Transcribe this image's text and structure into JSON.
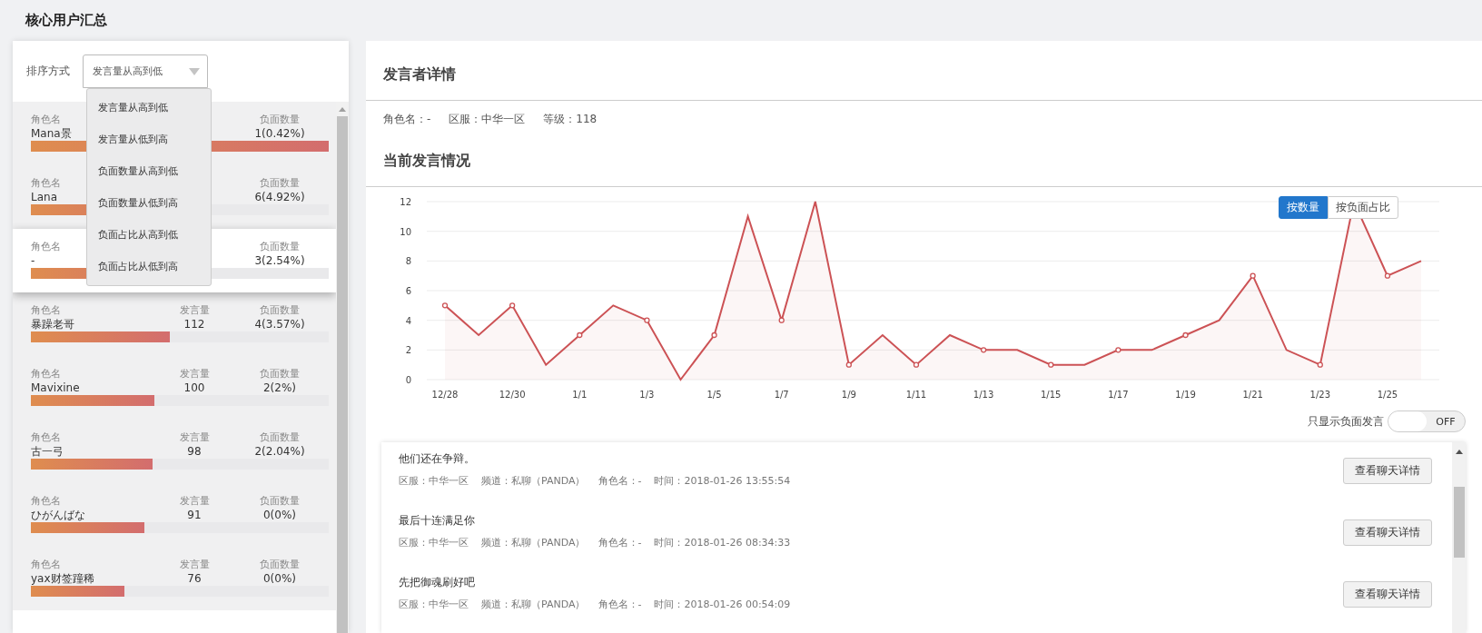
{
  "page_title": "核心用户汇总",
  "sort": {
    "label": "排序方式",
    "value": "发言量从高到低",
    "expanded": true,
    "options": [
      "发言量从高到低",
      "发言量从低到高",
      "负面数量从高到低",
      "负面数量从低到高",
      "负面占比从高到低",
      "负面占比从低到高"
    ]
  },
  "users": [
    {
      "name_label": "角色名",
      "name": "Mana景",
      "negative_label": "负面数量",
      "negative": "1(0.42%)",
      "level": 1.0,
      "selected": false
    },
    {
      "name_label": "角色名",
      "name": "Lana",
      "negative_label": "负面数量",
      "negative": "6(4.92%)",
      "level": 0.51,
      "selected": false
    },
    {
      "name_label": "角色名",
      "name": "-",
      "negative_label": "负面数量",
      "negative": "3(2.54%)",
      "level": 0.49,
      "selected": true
    },
    {
      "name_label": "角色名",
      "name": "暴躁老哥",
      "speech_label": "发言量",
      "speech": "112",
      "negative_label": "负面数量",
      "negative": "4(3.57%)",
      "level": 0.466,
      "selected": false
    },
    {
      "name_label": "角色名",
      "name": "Mavixine",
      "speech_label": "发言量",
      "speech": "100",
      "negative_label": "负面数量",
      "negative": "2(2%)",
      "level": 0.415,
      "selected": false
    },
    {
      "name_label": "角色名",
      "name": "古一弓",
      "speech_label": "发言量",
      "speech": "98",
      "negative_label": "负面数量",
      "negative": "2(2.04%)",
      "level": 0.409,
      "selected": false
    },
    {
      "name_label": "角色名",
      "name": "ひがんばな",
      "speech_label": "发言量",
      "speech": "91",
      "negative_label": "负面数量",
      "negative": "0(0%)",
      "level": 0.381,
      "selected": false
    },
    {
      "name_label": "角色名",
      "name": "yax财签蹱稀",
      "speech_label": "发言量",
      "speech": "76",
      "negative_label": "负面数量",
      "negative": "0(0%)",
      "level": 0.314,
      "selected": false
    }
  ],
  "speaker": {
    "title": "发言者详情",
    "info": [
      "角色名：-",
      "区服：中华一区",
      "等级：118"
    ]
  },
  "activity": {
    "title": "当前发言情况",
    "modes": [
      {
        "label": "按数量",
        "selected": true
      },
      {
        "label": "按负面占比",
        "selected": false
      }
    ],
    "chart_data": {
      "type": "area",
      "categories": [
        "12/28",
        null,
        "12/30",
        null,
        "1/1",
        null,
        "1/3",
        null,
        "1/5",
        null,
        "1/7",
        null,
        "1/9",
        null,
        "1/11",
        null,
        "1/13",
        null,
        "1/15",
        null,
        "1/17",
        null,
        "1/19",
        null,
        "1/21",
        null,
        "1/23",
        null,
        "1/25",
        null
      ],
      "series": [
        {
          "color": "#cc5255",
          "values": [
            5,
            3,
            5,
            1,
            3,
            5,
            4,
            0,
            3,
            11,
            4,
            12,
            1,
            3,
            1,
            3,
            2,
            2,
            1,
            1,
            2,
            2,
            3,
            4,
            7,
            2,
            1,
            12,
            7,
            8
          ]
        }
      ],
      "ylim": [
        0,
        12
      ],
      "yticks": [
        0,
        2,
        4,
        6,
        8,
        10,
        12
      ],
      "grid": true
    },
    "negative_only": {
      "label": "只显示负面发言",
      "on": false,
      "state_text": "OFF"
    }
  },
  "messages": [
    {
      "text": "他们还在争辩。",
      "meta": [
        "区服：中华一区",
        "频道：私聊（PANDA）",
        "角色名：-",
        "时间：2018-01-26 13:55:54"
      ],
      "button": "查看聊天详情"
    },
    {
      "text": "最后十连满足你",
      "meta": [
        "区服：中华一区",
        "频道：私聊（PANDA）",
        "角色名：-",
        "时间：2018-01-26 08:34:33"
      ],
      "button": "查看聊天详情"
    },
    {
      "text": "先把御魂刷好吧",
      "meta": [
        "区服：中华一区",
        "频道：私聊（PANDA）",
        "角色名：-",
        "时间：2018-01-26 00:54:09"
      ],
      "button": "查看聊天详情"
    }
  ]
}
